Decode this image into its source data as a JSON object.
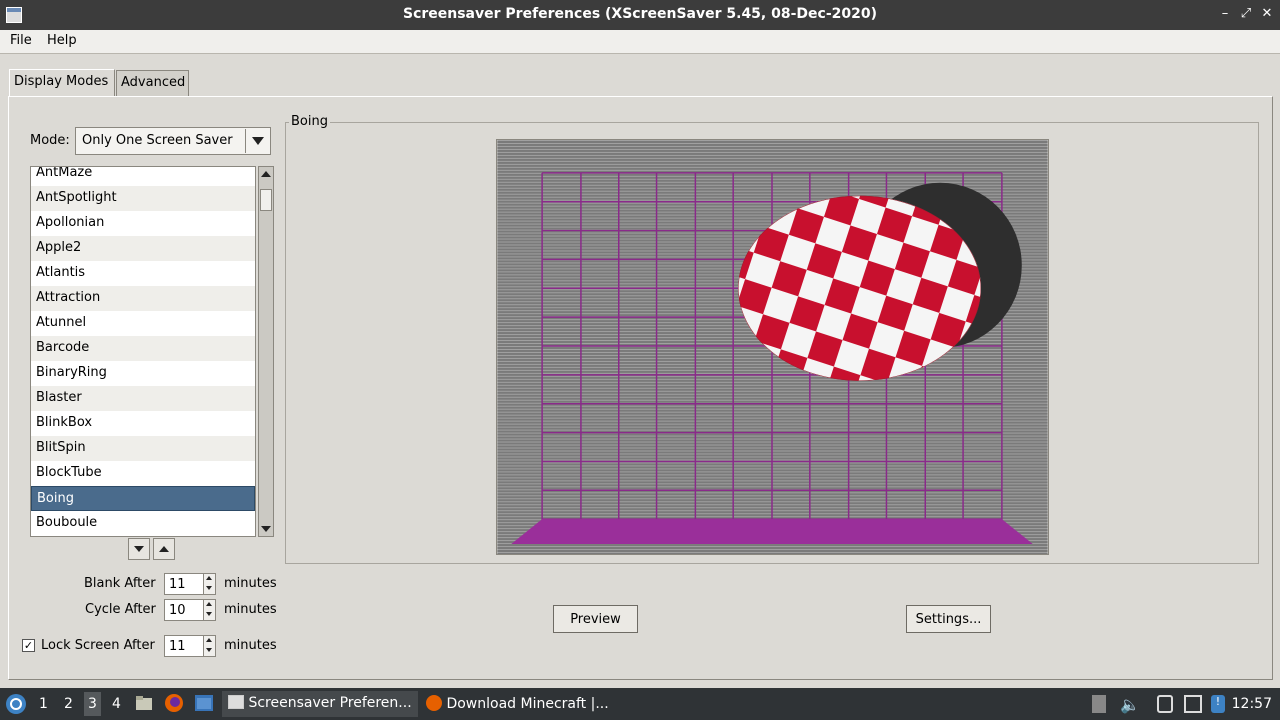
{
  "window": {
    "title": "Screensaver Preferences  (XScreenSaver 5.45, 08-Dec-2020)",
    "controls": [
      "–",
      "⤢",
      "✕"
    ]
  },
  "menubar": {
    "file": "File",
    "help": "Help"
  },
  "tabs": [
    {
      "label": "Display Modes",
      "active": true
    },
    {
      "label": "Advanced",
      "active": false
    }
  ],
  "mode": {
    "label": "Mode:",
    "value": "Only One Screen Saver"
  },
  "savers": [
    "AntMaze",
    "AntSpotlight",
    "Apollonian",
    "Apple2",
    "Atlantis",
    "Attraction",
    "Atunnel",
    "Barcode",
    "BinaryRing",
    "Blaster",
    "BlinkBox",
    "BlitSpin",
    "BlockTube",
    "Boing",
    "Bouboule"
  ],
  "selected_saver": "Boing",
  "timing": {
    "blank_label": "Blank After",
    "blank_value": "11",
    "cycle_label": "Cycle After",
    "cycle_value": "10",
    "lock_label": "Lock Screen After",
    "lock_value": "11",
    "lock_checked": true,
    "unit": "minutes"
  },
  "preview": {
    "frame_title": "Boing",
    "preview_button": "Preview",
    "settings_button": "Settings..."
  },
  "taskbar": {
    "workspaces": [
      "1",
      "2",
      "3",
      "4"
    ],
    "active_workspace": "3",
    "tasks": [
      {
        "label": "Screensaver Preferen...",
        "active": true
      },
      {
        "label": "Download Minecraft |...",
        "active": false
      }
    ],
    "clock": "12:57"
  },
  "colors": {
    "selection": "#4a6b8c",
    "checker_red": "#c8102e",
    "grid": "#8a2a8a",
    "floor": "#9a2f9a"
  }
}
